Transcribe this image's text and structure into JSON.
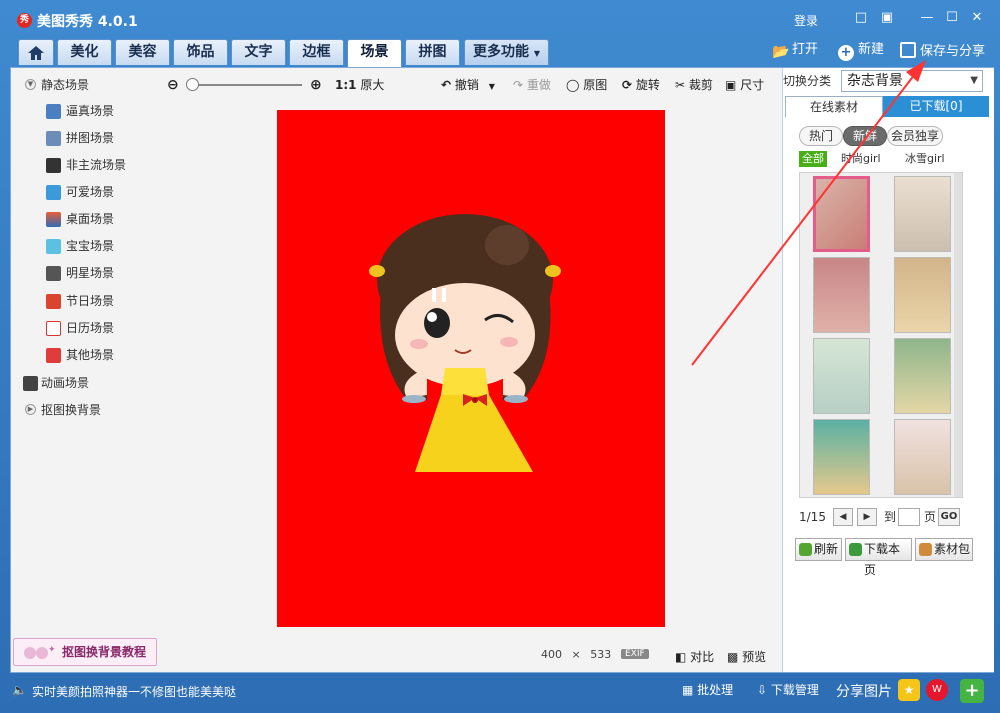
{
  "app": {
    "title": "美图秀秀 4.0.1",
    "logo_text": "秀",
    "login_label": "登录"
  },
  "nav": {
    "tabs": [
      "美化",
      "美容",
      "饰品",
      "文字",
      "边框",
      "场景",
      "拼图"
    ],
    "more_label": "更多功能",
    "active_tab": "场景"
  },
  "header_actions": {
    "open_label": "打开",
    "new_label": "新建",
    "save_label": "保存与分享"
  },
  "left_tree": {
    "static_group": "静态场景",
    "items": [
      "逼真场景",
      "拼图场景",
      "非主流场景",
      "可爱场景",
      "桌面场景",
      "宝宝场景",
      "明星场景",
      "节日场景",
      "日历场景",
      "其他场景"
    ],
    "animated_group": "动画场景",
    "cutout_group": "抠图换背景"
  },
  "tutorial_label": "抠图换背景教程",
  "toolbar": {
    "zoom_ratio": "1:1",
    "original_size_label": "原大",
    "undo_label": "撤销",
    "redo_label": "重做",
    "original_label": "原图",
    "rotate_label": "旋转",
    "crop_label": "裁剪",
    "size_label": "尺寸"
  },
  "canvas_info": {
    "width": "400",
    "x": "×",
    "height": "533",
    "exif": "EXIF",
    "compare_label": "对比",
    "preview_label": "预览"
  },
  "right_panel": {
    "category_label": "切换分类",
    "category_value": "杂志背景",
    "tabs": [
      "在线素材",
      "已下载[0]"
    ],
    "pills": [
      "热门",
      "新鲜",
      "会员独享"
    ],
    "filters": [
      "全部",
      "时尚girl",
      "冰雪girl"
    ],
    "page_info": "1/15",
    "goto_label": "到",
    "page_suffix": "页",
    "go_label": "GO",
    "buttons": [
      "刷新",
      "下载本页",
      "素材包"
    ]
  },
  "statusbar": {
    "tip": "实时美颜拍照神器一不修图也能美美哒",
    "batch_label": "批处理",
    "download_mgr_label": "下载管理",
    "share_label": "分享图片"
  },
  "colors": {
    "canvas_bg": "#ff0000",
    "arrow": "#ff3333",
    "accent_blue": "#2d6db4"
  }
}
